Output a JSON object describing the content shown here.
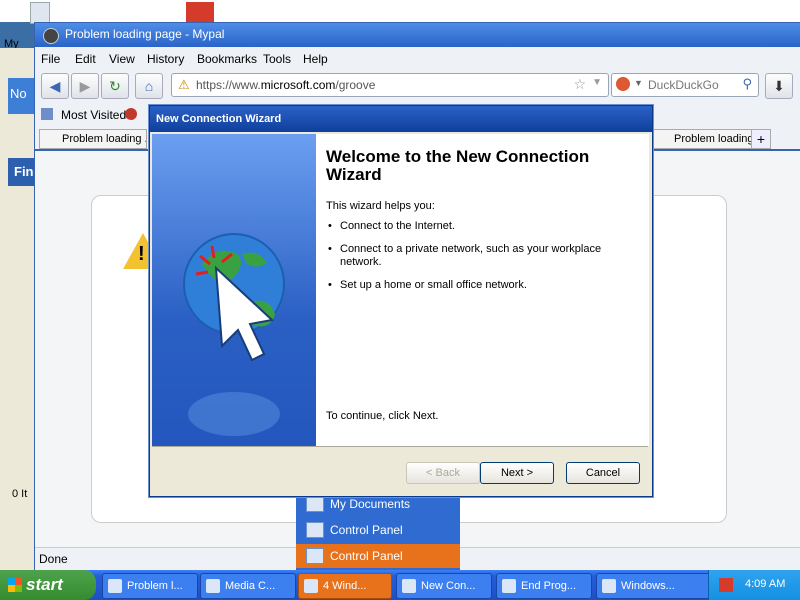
{
  "desktop": {
    "my_label": "My"
  },
  "bg_window": {
    "tab_text": "No",
    "find_text": "Fin",
    "count_text": "0 It"
  },
  "browser": {
    "title": "Problem loading page - Mypal",
    "menu": [
      "File",
      "Edit",
      "View",
      "History",
      "Bookmarks",
      "Tools",
      "Help"
    ],
    "url_prefix": "https://www.",
    "url_domain": "microsoft.com",
    "url_path": "/groove",
    "search_placeholder": "DuckDuckGo",
    "bookmark_most_visited": "Most Visited",
    "tabs": [
      "Problem loading ...",
      "Problem loading ..."
    ],
    "status": "Done"
  },
  "start_menu": {
    "items": [
      "My Documents",
      "Control Panel",
      "Control Panel"
    ]
  },
  "wizard": {
    "title": "New Connection Wizard",
    "heading": "Welcome to the New Connection Wizard",
    "intro": "This wizard helps you:",
    "bullets": [
      "Connect to the Internet.",
      "Connect to a private network, such as your workplace network.",
      "Set up a home or small office network."
    ],
    "continue_text": "To continue, click Next.",
    "back_label": "< Back",
    "next_label": "Next >",
    "cancel_label": "Cancel"
  },
  "taskbar": {
    "start_label": "start",
    "items": [
      "Problem l...",
      "Media C...",
      "4 Wind...",
      "New Con...",
      "End Prog...",
      "Windows..."
    ],
    "clock": "4:09 AM"
  },
  "colors": {
    "xp_blue": "#245edb",
    "start_green": "#348c2f",
    "active_orange": "#e8711c"
  }
}
